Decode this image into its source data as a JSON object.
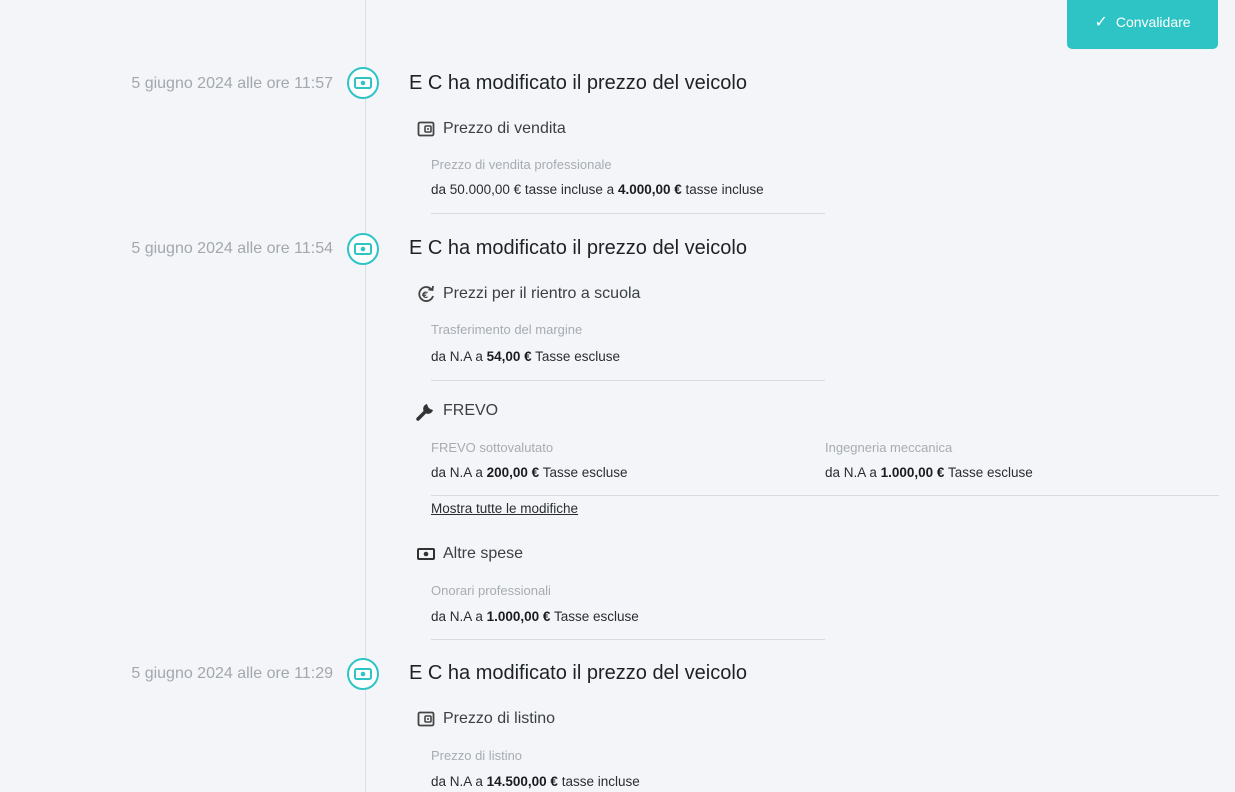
{
  "header": {
    "validate_label": "Convalidare"
  },
  "events": [
    {
      "date": "5 giugno 2024 alle ore 11:57",
      "title": "E C ha modificato il prezzo del veicolo",
      "sections": [
        {
          "title": "Prezzo di vendita",
          "fields": [
            {
              "label": "Prezzo di vendita professionale",
              "from_prefix": "da",
              "from_value": "50.000,00 €",
              "from_suffix": "tasse incluse a",
              "to_value": "4.000,00 €",
              "to_suffix": "tasse incluse"
            }
          ]
        }
      ]
    },
    {
      "date": "5 giugno 2024 alle ore 11:54",
      "title": "E C ha modificato il prezzo del veicolo",
      "sections": [
        {
          "title": "Prezzi per il rientro a scuola",
          "fields": [
            {
              "label": "Trasferimento del margine",
              "from_prefix": "da",
              "from_value": "N.A",
              "from_suffix": "a",
              "to_value": "54,00 €",
              "to_suffix": "Tasse escluse"
            }
          ]
        },
        {
          "title": "FREVO",
          "fields": [
            {
              "label": "FREVO sottovalutato",
              "from_prefix": "da",
              "from_value": "N.A",
              "from_suffix": "a",
              "to_value": "200,00 €",
              "to_suffix": "Tasse escluse"
            },
            {
              "label": "Ingegneria meccanica",
              "from_prefix": "da",
              "from_value": "N.A",
              "from_suffix": "a",
              "to_value": "1.000,00 €",
              "to_suffix": "Tasse escluse"
            }
          ],
          "show_all_label": "Mostra tutte le modifiche"
        },
        {
          "title": "Altre spese",
          "fields": [
            {
              "label": "Onorari professionali",
              "from_prefix": "da",
              "from_value": "N.A",
              "from_suffix": "a",
              "to_value": "1.000,00 €",
              "to_suffix": "Tasse escluse"
            }
          ]
        }
      ]
    },
    {
      "date": "5 giugno 2024 alle ore 11:29",
      "title": "E C ha modificato il prezzo del veicolo",
      "sections": [
        {
          "title": "Prezzo di listino",
          "fields": [
            {
              "label": "Prezzo di listino",
              "from_prefix": "da",
              "from_value": "N.A",
              "from_suffix": "a",
              "to_value": "14.500,00 €",
              "to_suffix": "tasse incluse"
            }
          ]
        }
      ]
    }
  ],
  "icons": {
    "event": "banknote-icon",
    "sale": "wallet-icon",
    "school": "euro-refresh-icon",
    "frevo": "wrench-icon",
    "other": "banknote-icon",
    "list": "wallet-icon"
  },
  "colors": {
    "accent": "#2ec4c6"
  }
}
